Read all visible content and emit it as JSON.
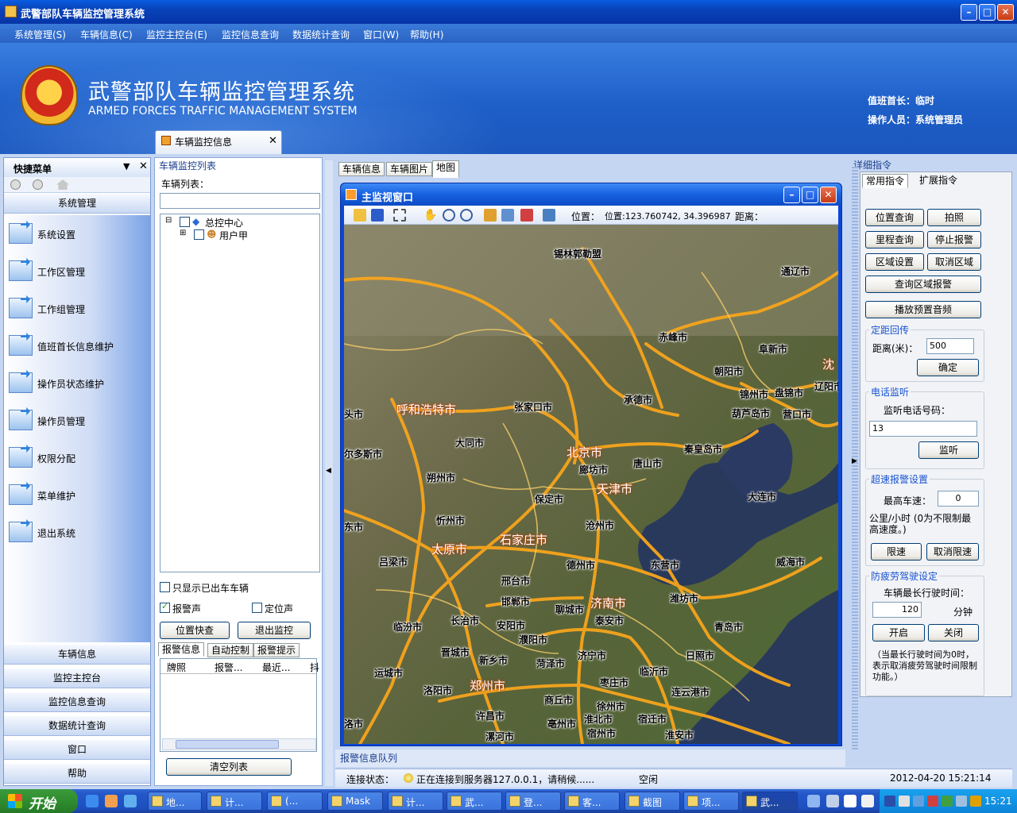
{
  "window": {
    "title": "武警部队车辆监控管理系统"
  },
  "menubar": [
    "系统管理(S)",
    "车辆信息(C)",
    "监控主控台(E)",
    "监控信息查询",
    "数据统计查询",
    "窗口(W)",
    "帮助(H)"
  ],
  "banner": {
    "title": "武警部队车辆监控管理系统",
    "subtitle": "ARMED FORCES TRAFFIC MANAGEMENT SYSTEM",
    "duty_chief": "值班首长：临时",
    "operator": "操作人员：系统管理员"
  },
  "doc_tab": {
    "label": "车辆监控信息"
  },
  "quick_menu": {
    "title": "快捷菜单",
    "active_group": "系统管理",
    "items": [
      "系统设置",
      "工作区管理",
      "工作组管理",
      "值班首长信息维护",
      "操作员状态维护",
      "操作员管理",
      "权限分配",
      "菜单维护",
      "退出系统"
    ],
    "groups": [
      "车辆信息",
      "监控主控台",
      "监控信息查询",
      "数据统计查询",
      "窗口",
      "帮助"
    ]
  },
  "vehicle_panel": {
    "title": "车辆监控列表",
    "list_label": "车辆列表：",
    "tree": {
      "root": "总控中心",
      "child": "用户甲"
    },
    "only_out": "只显示已出车车辆",
    "alarm_sound": "报警声",
    "locate_sound": "定位声",
    "btn_locate": "位置快查",
    "btn_exit": "退出监控",
    "tabs": [
      "报警信息",
      "自动控制",
      "报警提示"
    ],
    "grid_headers": [
      "牌照",
      "报警...",
      "最近...",
      "抖"
    ],
    "btn_clear": "清空列表"
  },
  "center_tabs": [
    "车辆信息",
    "车辆图片",
    "地图"
  ],
  "map_window": {
    "title": "主监视窗口",
    "position_label": "位置：",
    "position_value": "位置:123.760742, 34.396987",
    "distance_label": "距离："
  },
  "map_cities": {
    "xilinhot": "锡林郭勒盟",
    "tongliao": "通辽市",
    "chifeng": "赤峰市",
    "fuxin": "阜新市",
    "chaoyang": "朝阳市",
    "shen": "沈",
    "jinzhou": "锦州市",
    "panjin": "盘锦市",
    "liaoyang": "辽阳市",
    "hohhot": "呼和浩特市",
    "zhangjiakou": "张家口市",
    "chengde": "承德市",
    "huludao": "葫芦岛市",
    "yingkou": "营口市",
    "datong": "大同市",
    "beijing": "北京市",
    "qinhuangdao": "秦皇岛市",
    "tangshan": "唐山市",
    "langfang": "廊坊市",
    "ordos": "尔多斯市",
    "shuozhou": "朔州市",
    "tianjin": "天津市",
    "dalian": "大连市",
    "baoding": "保定市",
    "xinzhou": "忻州市",
    "cangzhou": "沧州市",
    "taiyuan": "太原市",
    "shijiazhuang": "石家庄市",
    "lvliang": "吕梁市",
    "dezhou": "德州市",
    "dongying": "东营市",
    "weihai": "威海市",
    "xingtai": "邢台市",
    "handan": "邯郸市",
    "jinan": "济南市",
    "weifang": "潍坊市",
    "liaocheng": "聊城市",
    "taian": "泰安市",
    "linfen": "临汾市",
    "changzhi": "长治市",
    "anyang": "安阳市",
    "qingdao": "青岛市",
    "puyang": "濮阳市",
    "jincheng": "晋城市",
    "xinxiang": "新乡市",
    "jining": "济宁市",
    "rizhao": "日照市",
    "yuncheng": "运城市",
    "heze": "菏泽市",
    "linyi": "临沂市",
    "zaozhuang": "枣庄市",
    "luoyang": "洛阳市",
    "zhengzhou": "郑州市",
    "lianyungang": "连云港市",
    "shangqiu": "商丘市",
    "xuzhou": "徐州市",
    "xuchang": "许昌市",
    "bozhou": "亳州市",
    "huaibei": "淮北市",
    "suqian": "宿迁市",
    "luo": "洛市",
    "luohe": "漯河市",
    "suzhou": "宿州市",
    "huaian": "淮安市",
    "w1": "头市",
    "w2": "尔多斯市",
    "w3": "东市"
  },
  "alarm_queue": "报警信息队列",
  "status": {
    "conn_label": "连接状态：",
    "conn_text": "正在连接到服务器127.0.0.1，请稍候......",
    "idle": "空闲",
    "datetime": "2012-04-20 15:21:14"
  },
  "right_panel": {
    "title": "详细指令",
    "tabs": [
      "常用指令",
      "扩展指令"
    ],
    "buttons": {
      "pos_query": "位置查询",
      "photo": "拍照",
      "mileage": "里程查询",
      "stop_alarm": "停止报警",
      "area_set": "区域设置",
      "cancel_area": "取消区域",
      "query_area_alarm": "查询区域报警",
      "play_audio": "播放预置音频"
    },
    "fixed": {
      "legend": "定距回传",
      "label": "距离(米)：",
      "value": "500",
      "ok": "确定"
    },
    "phone": {
      "legend": "电话监听",
      "label": "监听电话号码：",
      "value": "13",
      "btn": "监听"
    },
    "speed": {
      "legend": "超速报警设置",
      "label": "最高车速：",
      "value": "0",
      "note": "公里/小时 (0为不限制最高速度。)",
      "limit": "限速",
      "cancel": "取消限速"
    },
    "fatigue": {
      "legend": "防疲劳驾驶设定",
      "label": "车辆最长行驶时间：",
      "value": "120",
      "unit": "分钟",
      "on": "开启",
      "off": "关闭",
      "note": "（当最长行驶时间为0时，表示取消疲劳驾驶时间限制功能。）"
    }
  },
  "taskbar": {
    "start": "开始",
    "tasks": [
      "地...",
      "计...",
      "(...",
      "Mask",
      "计...",
      "武...",
      "登...",
      "客...",
      "截图",
      "项...",
      "武..."
    ],
    "clock": "15:21"
  }
}
